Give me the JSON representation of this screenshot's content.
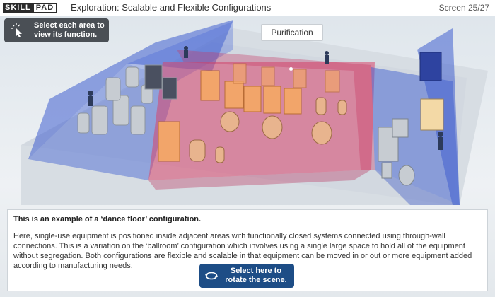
{
  "header": {
    "logo_part1": "SKILL",
    "logo_part2": "PAD",
    "title": "Exploration: Scalable and Flexible Configurations",
    "screen_counter": "Screen 25/27"
  },
  "hint": {
    "text": "Select each area to view its function."
  },
  "scene": {
    "area_label": "Purification",
    "colors": {
      "left_zone": "#3f5fd0",
      "center_zone": "#d8456b",
      "right_zone": "#3f5fd0",
      "tote": "#f2a56a"
    }
  },
  "info": {
    "heading": "This is an example of a ‘dance floor’ configuration.",
    "body": "Here, single-use equipment is positioned inside adjacent areas with functionally closed systems connected using through-wall connections. This is a variation on the ‘ballroom’ configuration which involves using a single large space to hold all of the equipment without segregation. Both configurations are flexible and scalable in that equipment can be moved in or out or more equipment added according to manufacturing needs."
  },
  "rotate_button": {
    "text": "Select here to rotate the scene."
  }
}
